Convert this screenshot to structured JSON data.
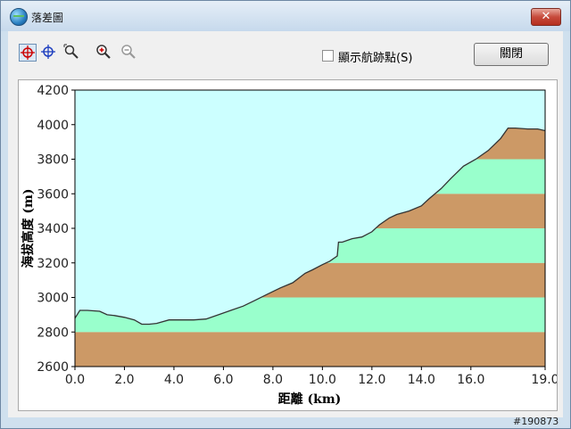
{
  "window": {
    "title": "落差圖",
    "close_glyph": "✕",
    "app_icon": "globe-icon"
  },
  "toolbar": {
    "tools": [
      {
        "name": "red-crosshair-icon",
        "color": "#cc0000",
        "active": true
      },
      {
        "name": "blue-crosshair-icon",
        "color": "#2040c0",
        "active": false
      },
      {
        "name": "zoom-select-icon",
        "color": "#333333",
        "active": false
      },
      {
        "name": "zoom-in-icon",
        "color": "#333333",
        "active": false
      },
      {
        "name": "zoom-out-icon",
        "color": "#999999",
        "active": false
      }
    ],
    "waypoint_checkbox_label": "顯示航跡點(S)",
    "waypoint_checked": false,
    "close_button_label": "關閉"
  },
  "chart_data": {
    "type": "area",
    "ylabel": "海拔高度 (m)",
    "xlabel": "距離 (km)",
    "x_unit": "km",
    "y_unit": "m",
    "xlim": [
      0,
      19
    ],
    "ylim": [
      2600,
      4200
    ],
    "x_ticks": [
      "0.0",
      "2.0",
      "4.0",
      "6.0",
      "8.0",
      "10.0",
      "12.0",
      "14.0",
      "16.0",
      "19.0"
    ],
    "x_tick_values": [
      0,
      2,
      4,
      6,
      8,
      10,
      12,
      14,
      16,
      19
    ],
    "y_ticks": [
      "2600",
      "2800",
      "3000",
      "3200",
      "3400",
      "3600",
      "3800",
      "4000",
      "4200"
    ],
    "band_step": 200,
    "colors": {
      "sky": "#ccffff",
      "band_dark": "#cc9966",
      "band_light": "#99ffcc",
      "line": "#333333"
    },
    "profile": {
      "x": [
        0.0,
        0.2,
        0.5,
        1.0,
        1.3,
        1.6,
        2.0,
        2.4,
        2.7,
        3.0,
        3.3,
        3.8,
        4.3,
        4.8,
        5.3,
        5.8,
        6.3,
        6.8,
        7.3,
        7.8,
        8.3,
        8.8,
        9.3,
        9.6,
        10.0,
        10.3,
        10.6,
        10.65,
        10.8,
        11.2,
        11.6,
        12.0,
        12.3,
        12.7,
        13.0,
        13.5,
        14.0,
        14.3,
        14.8,
        15.2,
        15.7,
        16.2,
        16.7,
        17.2,
        17.5,
        17.8,
        18.3,
        18.7,
        19.0
      ],
      "y": [
        2880,
        2925,
        2925,
        2920,
        2900,
        2895,
        2885,
        2870,
        2845,
        2845,
        2850,
        2870,
        2870,
        2870,
        2875,
        2900,
        2925,
        2950,
        2985,
        3020,
        3055,
        3085,
        3140,
        3160,
        3190,
        3210,
        3240,
        3320,
        3320,
        3340,
        3350,
        3380,
        3420,
        3460,
        3480,
        3500,
        3530,
        3570,
        3630,
        3690,
        3760,
        3800,
        3850,
        3920,
        3980,
        3980,
        3975,
        3975,
        3965
      ]
    }
  },
  "watermark": "#190873"
}
